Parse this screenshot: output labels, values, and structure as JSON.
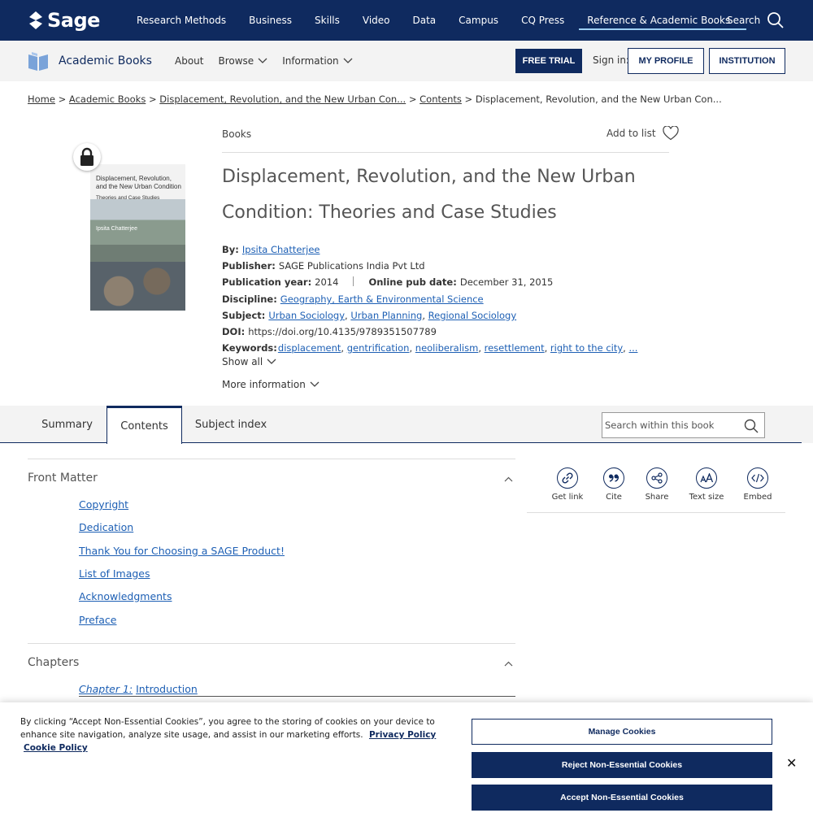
{
  "top_nav": {
    "logo": "Sage",
    "links": [
      "Research Methods",
      "Business",
      "Skills",
      "Video",
      "Data",
      "Campus",
      "CQ Press",
      "Reference & Academic Books"
    ],
    "active_index": 7,
    "search_label": "Search"
  },
  "sub_nav": {
    "brand": "Academic Books",
    "about": "About",
    "browse": "Browse",
    "information": "Information",
    "free_trial": "FREE TRIAL",
    "sign_in": "Sign in:",
    "my_profile": "MY PROFILE",
    "institution": "INSTITUTION"
  },
  "breadcrumb": {
    "home": "Home",
    "academic_books": "Academic Books",
    "book": "Displacement, Revolution, and the New Urban Con...",
    "contents": "Contents",
    "current": "Displacement, Revolution, and the New Urban Con...",
    "separator": ">"
  },
  "cover": {
    "title": "Displacement, Revolution, and the New Urban Condition",
    "subtitle": "Theories and Case Studies",
    "author": "Ipsita Chatterjee"
  },
  "book": {
    "type": "Books",
    "add_to_list": "Add to list",
    "title": "Displacement, Revolution, and the New Urban Condition: Theories and Case Studies",
    "by_label": "By:",
    "author": "Ipsita Chatterjee",
    "publisher_label": "Publisher:",
    "publisher": "SAGE Publications India Pvt Ltd",
    "pubyear_label": "Publication year:",
    "pubyear": "2014",
    "online_label": "Online pub date:",
    "online_date": "December 31, 2015",
    "discipline_label": "Discipline:",
    "discipline": "Geography, Earth & Environmental Science",
    "subject_label": "Subject:",
    "subjects": [
      "Urban Sociology",
      "Urban Planning",
      "Regional Sociology"
    ],
    "doi_label": "DOI:",
    "doi": "https://doi.org/10.4135/9789351507789",
    "keywords_label": "Keywords:",
    "keywords": [
      "displacement",
      "gentrification",
      "neoliberalism",
      "resettlement",
      "right to the city",
      "..."
    ],
    "show_all": "Show all",
    "more_info": "More information"
  },
  "tabs": [
    {
      "label": "Summary"
    },
    {
      "label": "Contents"
    },
    {
      "label": "Subject index"
    }
  ],
  "active_tab": 1,
  "search_book": {
    "placeholder": "Search within this book"
  },
  "front_matter": {
    "title": "Front Matter",
    "items": [
      "Copyright",
      "Dedication",
      "Thank You for Choosing a SAGE Product!",
      "List of Images",
      "Acknowledgments",
      "Preface"
    ]
  },
  "chapters": {
    "title": "Chapters",
    "items": [
      {
        "num": "Chapter 1:",
        "title": "Introduction"
      }
    ]
  },
  "tools": [
    "Get link",
    "Cite",
    "Share",
    "Text size",
    "Embed"
  ],
  "cookie": {
    "text": "By clicking “Accept Non-Essential Cookies”, you agree to the storing of cookies on your device to enhance site navigation, analyze site usage, and assist in our marketing efforts.",
    "privacy": "Privacy Policy",
    "cookie_policy": "Cookie Policy",
    "manage": "Manage Cookies",
    "reject": "Reject Non-Essential Cookies",
    "accept": "Accept Non-Essential Cookies"
  },
  "colors": {
    "navy": "#0f2a5f",
    "link": "#1d5fb4",
    "light_bar": "#f3f3f3"
  }
}
